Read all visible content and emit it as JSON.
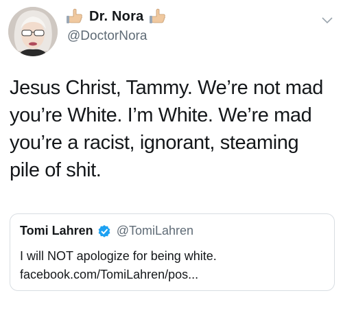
{
  "author": {
    "display_name": "Dr. Nora",
    "handle": "@DoctorNora",
    "name_icons": [
      "thumbs-up-hand-icon",
      "thumbs-up-hand-icon"
    ]
  },
  "tweet": {
    "text": "Jesus Christ, Tammy. We’re not mad you’re White. I’m White. We’re mad you’re a racist, ignorant, steaming pile of shit."
  },
  "quoted_tweet": {
    "display_name": "Tomi Lahren",
    "verified": true,
    "handle": "@TomiLahren",
    "text_line1": "I will NOT apologize for being white.",
    "text_line2": "facebook.com/TomiLahren/pos..."
  },
  "colors": {
    "text": "#14171a",
    "secondary_text": "#5f6b76",
    "verified_blue": "#1da1f2",
    "border": "#d8dde2"
  }
}
